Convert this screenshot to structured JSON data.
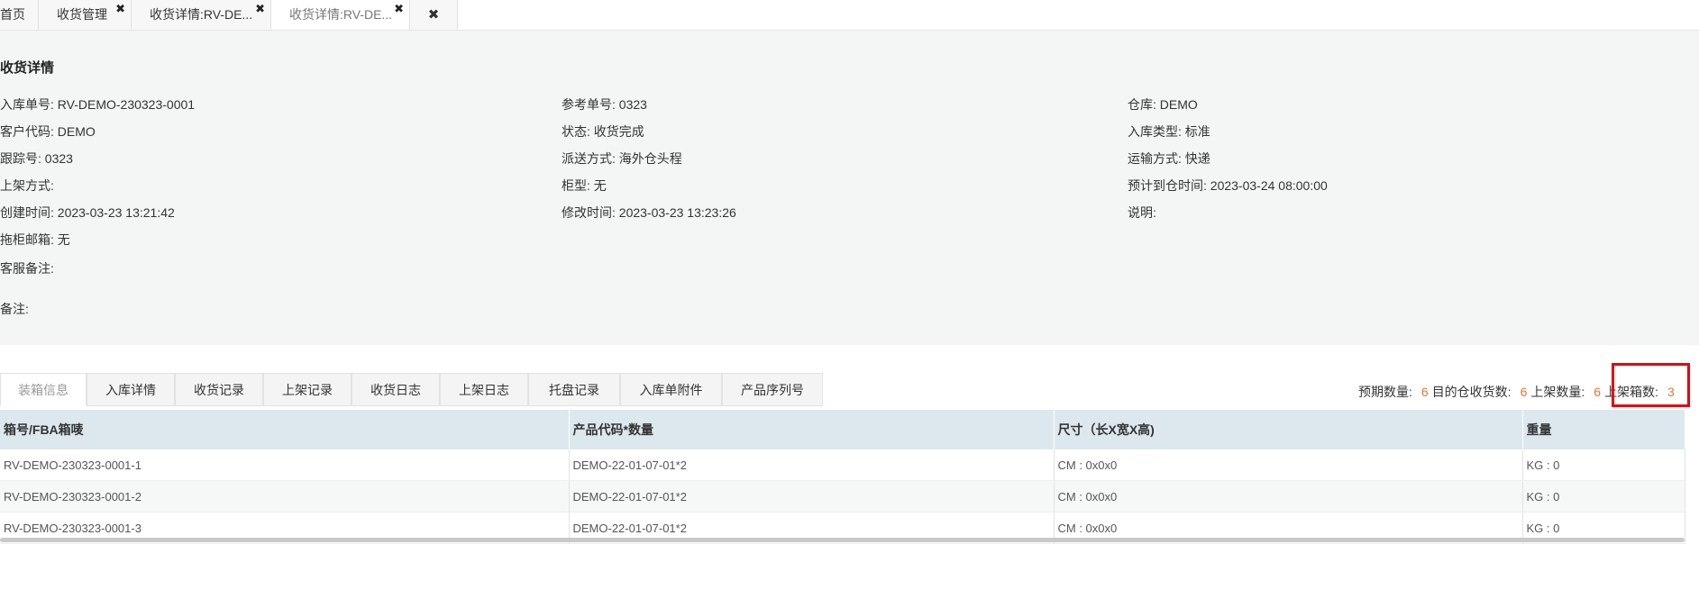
{
  "tabs": [
    {
      "label": "首页",
      "closable": false,
      "active": false
    },
    {
      "label": "收货管理",
      "closable": true,
      "active": false
    },
    {
      "label": "收货详情:RV-DE...",
      "closable": true,
      "active": false
    },
    {
      "label": "收货详情:RV-DE...",
      "closable": true,
      "active": true
    }
  ],
  "tab_close_glyph": "✖",
  "close_all_glyph": "✖",
  "detail": {
    "title": "收货详情",
    "fields": {
      "inbound_no": {
        "label": "入库单号:",
        "value": "RV-DEMO-230323-0001"
      },
      "ref_no": {
        "label": "参考单号:",
        "value": "0323"
      },
      "warehouse": {
        "label": "仓库:",
        "value": "DEMO"
      },
      "customer_code": {
        "label": "客户代码:",
        "value": "DEMO"
      },
      "status": {
        "label": "状态:",
        "value": "收货完成"
      },
      "inbound_type": {
        "label": "入库类型:",
        "value": "标准"
      },
      "tracking_no": {
        "label": "跟踪号:",
        "value": "0323"
      },
      "delivery_method": {
        "label": "派送方式:",
        "value": "海外仓头程"
      },
      "shipping_method": {
        "label": "运输方式:",
        "value": "快递"
      },
      "putaway_method": {
        "label": "上架方式:",
        "value": ""
      },
      "cabinet_type": {
        "label": "柜型:",
        "value": "无"
      },
      "eta": {
        "label": "预计到仓时间:",
        "value": "2023-03-24 08:00:00"
      },
      "created_time": {
        "label": "创建时间:",
        "value": "2023-03-23 13:21:42"
      },
      "modified_time": {
        "label": "修改时间:",
        "value": "2023-03-23 13:23:26"
      },
      "description": {
        "label": "说明:",
        "value": ""
      },
      "container_mailbox": {
        "label": "拖柜邮箱:",
        "value": "无"
      },
      "cs_remark": {
        "label": "客服备注:",
        "value": ""
      },
      "remark": {
        "label": "备注:",
        "value": ""
      }
    }
  },
  "subtabs": [
    "装箱信息",
    "入库详情",
    "收货记录",
    "上架记录",
    "收货日志",
    "上架日志",
    "托盘记录",
    "入库单附件",
    "产品序列号"
  ],
  "summary": {
    "expected_qty": {
      "label": "预期数量:",
      "value": "6"
    },
    "dest_received_qty": {
      "label": "目的仓收货数:",
      "value": "6"
    },
    "putaway_qty": {
      "label": "上架数量:",
      "value": "6"
    },
    "putaway_boxes": {
      "label": "上架箱数:",
      "value": "3"
    }
  },
  "table": {
    "headers": [
      "箱号/FBA箱唛",
      "产品代码*数量",
      "尺寸（长X宽X高)",
      "重量"
    ],
    "rows": [
      [
        "RV-DEMO-230323-0001-1",
        "DEMO-22-01-07-01*2",
        "CM : 0x0x0",
        "KG : 0"
      ],
      [
        "RV-DEMO-230323-0001-2",
        "DEMO-22-01-07-01*2",
        "CM : 0x0x0",
        "KG : 0"
      ],
      [
        "RV-DEMO-230323-0001-3",
        "DEMO-22-01-07-01*2",
        "CM : 0x0x0",
        "KG : 0"
      ]
    ]
  },
  "colors": {
    "accent_number": "#e8762e",
    "highlight": "#e8000d",
    "panel_bg": "#f3f6f5",
    "table_header_bg": "#dde8ee"
  }
}
